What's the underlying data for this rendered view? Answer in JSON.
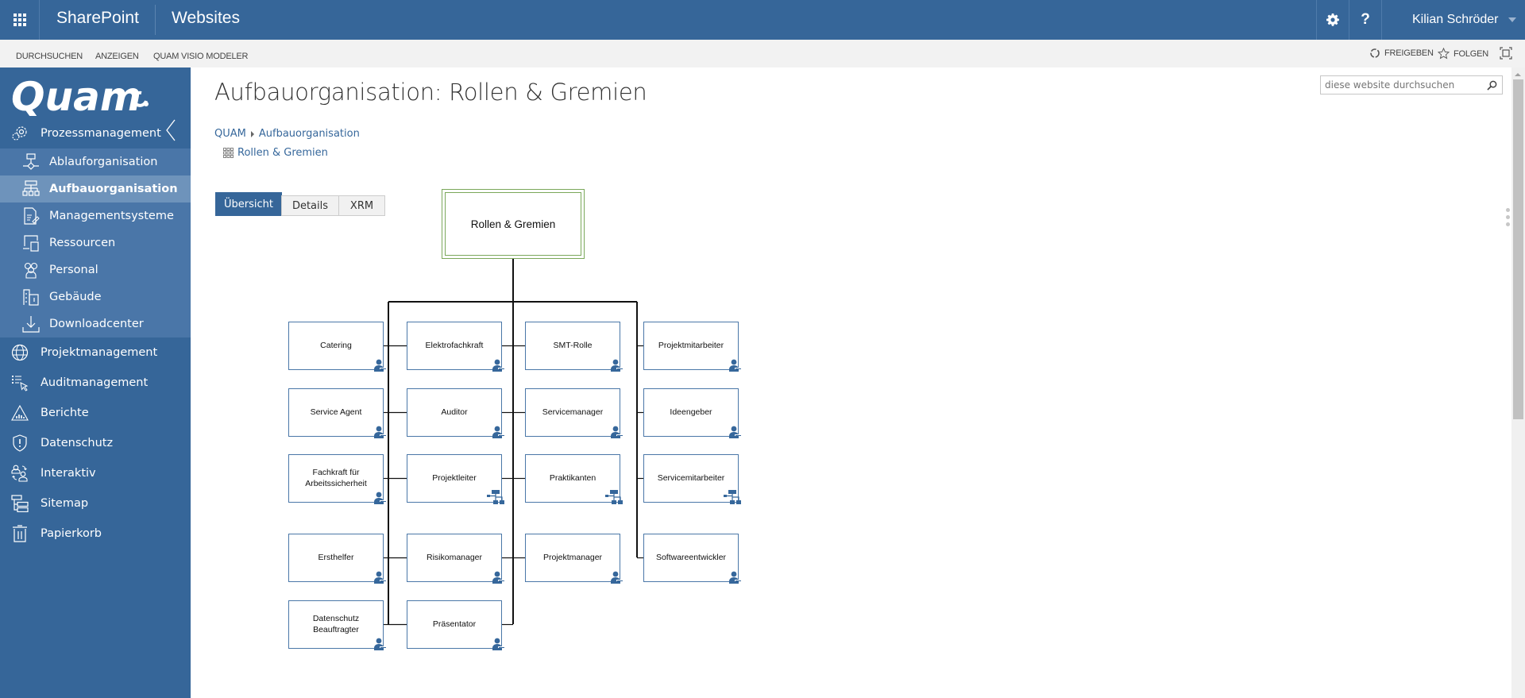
{
  "suitebar": {
    "brand": "SharePoint",
    "site_title": "Websites",
    "help_label": "?",
    "user_name": "Kilian Schröder",
    "icons": [
      "app-launcher-icon",
      "gear-icon",
      "help-icon",
      "chevron-down-icon"
    ]
  },
  "ribbon": {
    "tabs": [
      "DURCHSUCHEN",
      "ANZEIGEN",
      "QUAM VISIO MODELER"
    ],
    "share_label": "FREIGEBEN",
    "follow_label": "FOLGEN"
  },
  "sidebar": {
    "logo_text": "Quam",
    "items": [
      {
        "label": "Prozessmanagement",
        "icon": "gears-icon",
        "level": "top"
      },
      {
        "label": "Ablauforganisation",
        "icon": "flowchart-icon",
        "level": "sub"
      },
      {
        "label": "Aufbauorganisation",
        "icon": "org-chart-icon",
        "level": "sub",
        "active": true
      },
      {
        "label": "Managementsysteme",
        "icon": "document-edit-icon",
        "level": "sub"
      },
      {
        "label": "Ressourcen",
        "icon": "devices-icon",
        "level": "sub"
      },
      {
        "label": "Personal",
        "icon": "people-icon",
        "level": "sub"
      },
      {
        "label": "Gebäude",
        "icon": "building-icon",
        "level": "sub"
      },
      {
        "label": "Downloadcenter",
        "icon": "download-icon",
        "level": "sub"
      },
      {
        "label": "Projektmanagement",
        "icon": "globe-icon",
        "level": "top"
      },
      {
        "label": "Auditmanagement",
        "icon": "checklist-cursor-icon",
        "level": "top"
      },
      {
        "label": "Berichte",
        "icon": "chart-triangle-icon",
        "level": "top"
      },
      {
        "label": "Datenschutz",
        "icon": "shield-icon",
        "level": "top"
      },
      {
        "label": "Interaktiv",
        "icon": "user-exchange-icon",
        "level": "top"
      },
      {
        "label": "Sitemap",
        "icon": "sitemap-icon",
        "level": "top"
      },
      {
        "label": "Papierkorb",
        "icon": "trash-icon",
        "level": "top"
      }
    ]
  },
  "main": {
    "title": "Aufbauorganisation: Rollen & Gremien",
    "search_placeholder": "diese website durchsuchen",
    "breadcrumb": [
      "QUAM",
      "Aufbauorganisation"
    ],
    "current": "Rollen & Gremien",
    "tabs": [
      {
        "label": "Übersicht",
        "active": true
      },
      {
        "label": "Details"
      },
      {
        "label": "XRM"
      }
    ]
  },
  "orgchart": {
    "root": "Rollen & Gremien",
    "columns": [
      [
        {
          "label": "Catering",
          "type": "role"
        },
        {
          "label": "Service Agent",
          "type": "role"
        },
        {
          "label": "Fachkraft für Arbeitssicherheit",
          "type": "role"
        },
        {
          "label": "Ersthelfer",
          "type": "role"
        },
        {
          "label": "Datenschutz Beauftragter",
          "type": "role"
        }
      ],
      [
        {
          "label": "Elektrofachkraft",
          "type": "role"
        },
        {
          "label": "Auditor",
          "type": "role"
        },
        {
          "label": "Projektleiter",
          "type": "org-unit"
        },
        {
          "label": "Risikomanager",
          "type": "role"
        },
        {
          "label": "Präsentator",
          "type": "role"
        }
      ],
      [
        {
          "label": "SMT-Rolle",
          "type": "role"
        },
        {
          "label": "Servicemanager",
          "type": "role"
        },
        {
          "label": "Praktikanten",
          "type": "org-unit"
        },
        {
          "label": "Projektmanager",
          "type": "role"
        }
      ],
      [
        {
          "label": "Projektmitarbeiter",
          "type": "role"
        },
        {
          "label": "Ideengeber",
          "type": "role"
        },
        {
          "label": "Servicemitarbeiter",
          "type": "org-unit"
        },
        {
          "label": "Softwareentwickler",
          "type": "role"
        }
      ]
    ]
  },
  "colors": {
    "brand_blue": "#366699",
    "sidebar_sub": "#4a76a8",
    "sidebar_active": "#6e93bb",
    "node_border": "#4a77a8",
    "root_border": "#7aa85a",
    "icon_blue": "#36679b"
  }
}
